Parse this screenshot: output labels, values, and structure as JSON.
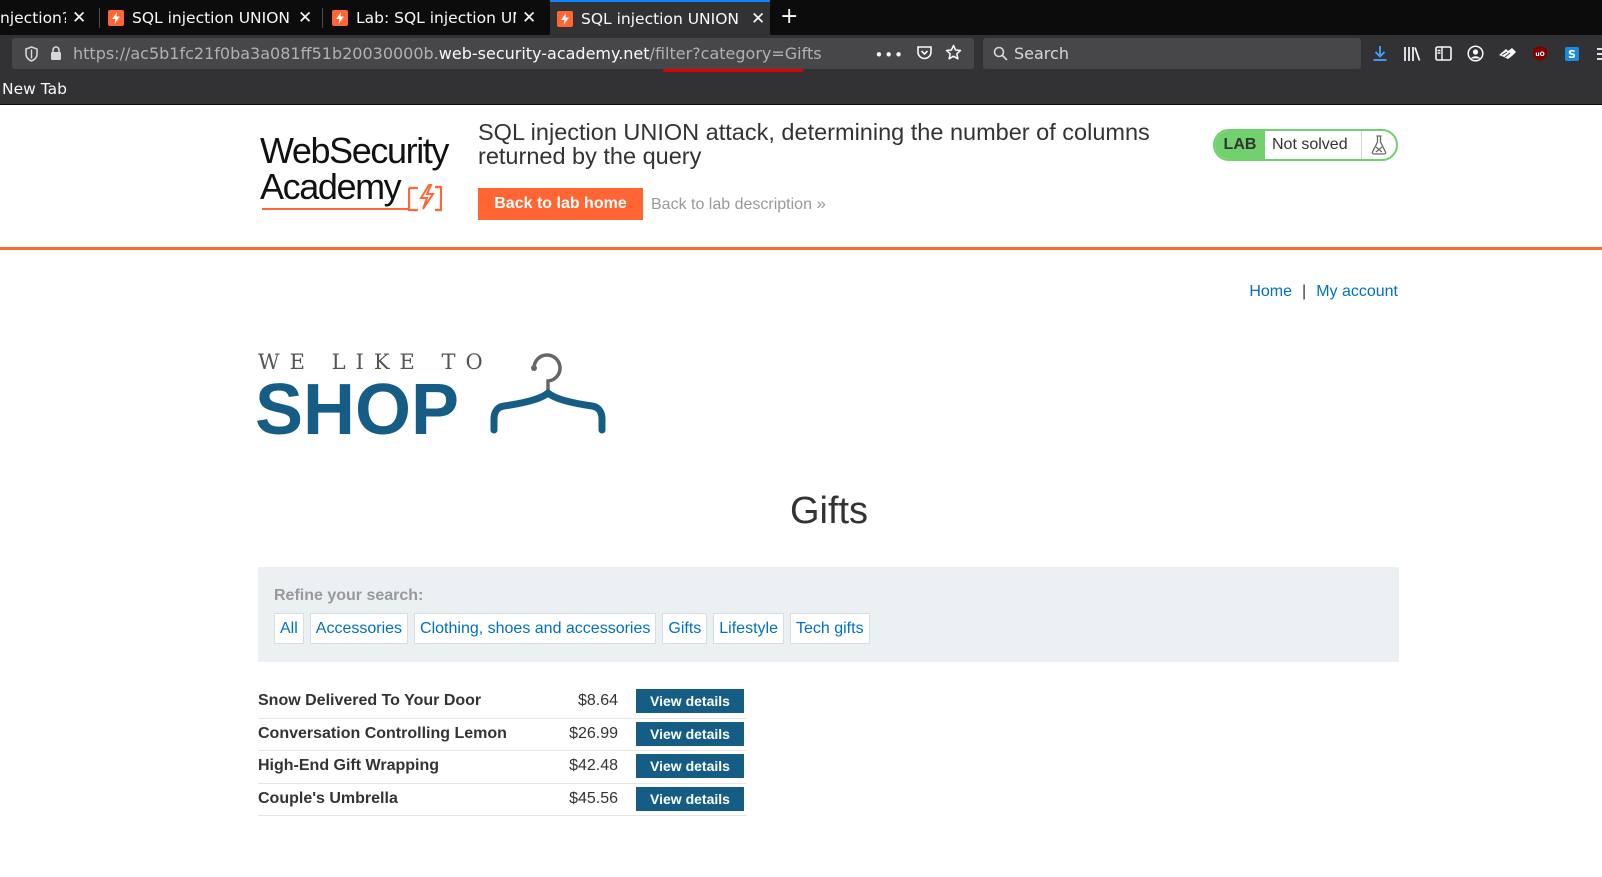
{
  "browser": {
    "tabs": [
      {
        "title": "njection?",
        "active": false,
        "has_favicon": false
      },
      {
        "title": "SQL injection UNION a",
        "active": false,
        "has_favicon": true
      },
      {
        "title": "Lab: SQL injection UNI",
        "active": false,
        "has_favicon": true
      },
      {
        "title": "SQL injection UNION a",
        "active": true,
        "has_favicon": true
      }
    ],
    "new_tab_symbol": "+",
    "close_symbol": "✕",
    "url": {
      "prefix": "https://ac5b1fc21f0ba3a081ff51b20030000b.",
      "domain": "web-security-academy.net",
      "path": "/filter?category=Gifts"
    },
    "search_placeholder": "Search",
    "bookmark": "New Tab",
    "icons": [
      "download-icon",
      "library-icon",
      "sidebar-icon",
      "account-icon",
      "extension-icon",
      "ublock-icon",
      "s-extension-icon",
      "menu-icon"
    ],
    "accent": "#0a84ff"
  },
  "lab": {
    "logo_line1": "WebSecurity",
    "logo_line2": "Academy",
    "title": "SQL injection UNION attack, determining the number of columns returned by the query",
    "back_home": "Back to lab home",
    "back_description": "Back to lab description",
    "chevrons": "»",
    "status_badge": "LAB",
    "status_text": "Not solved",
    "brand_color": "#ff6633",
    "badge_color": "#70d16d"
  },
  "shop": {
    "nav": {
      "home": "Home",
      "separator": "|",
      "account": "My account"
    },
    "tagline": "WE LIKE TO",
    "logo_word": "SHOP",
    "category_title": "Gifts",
    "refine_label": "Refine your search:",
    "filters": [
      "All",
      "Accessories",
      "Clothing, shoes and accessories",
      "Gifts",
      "Lifestyle",
      "Tech gifts"
    ],
    "products": [
      {
        "name": "Snow Delivered To Your Door",
        "price": "$8.64",
        "action": "View details"
      },
      {
        "name": "Conversation Controlling Lemon",
        "price": "$26.99",
        "action": "View details"
      },
      {
        "name": "High-End Gift Wrapping",
        "price": "$42.48",
        "action": "View details"
      },
      {
        "name": "Couple's Umbrella",
        "price": "$45.56",
        "action": "View details"
      }
    ],
    "primary_color": "#155d85",
    "link_color": "#0071bc"
  }
}
